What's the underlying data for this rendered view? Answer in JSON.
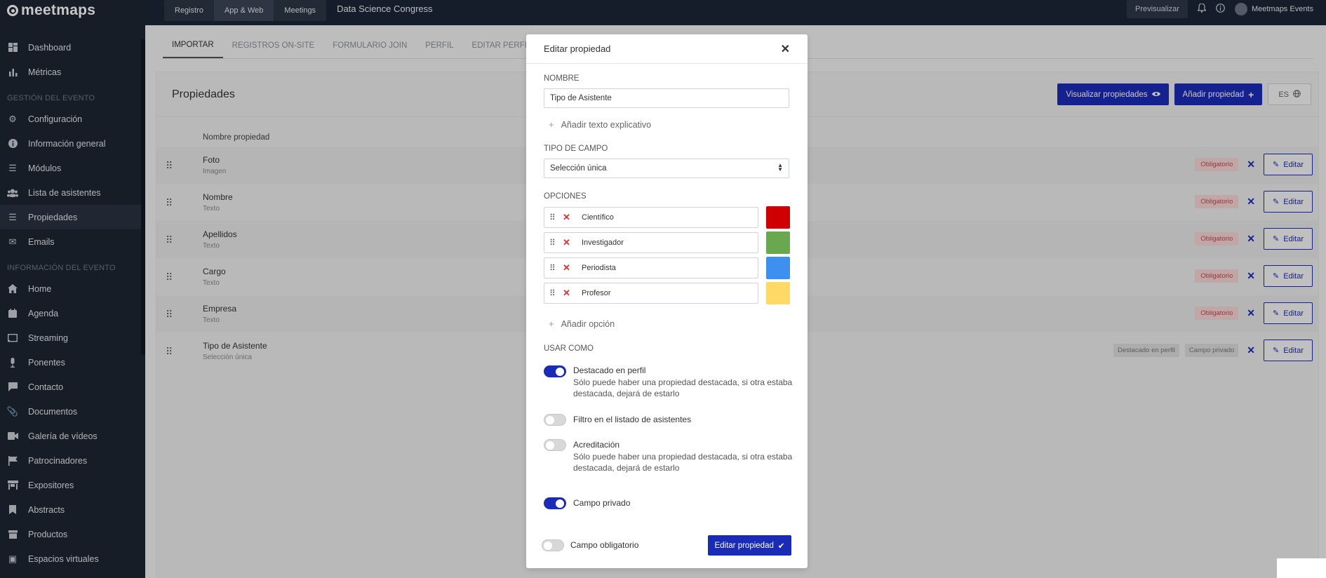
{
  "brand": "meetmaps",
  "sidebar": {
    "items_top": [
      {
        "label": "Dashboard",
        "icon": "dashboard-icon"
      },
      {
        "label": "Métricas",
        "icon": "bar-chart-icon"
      }
    ],
    "section_gestion": "GESTIÓN DEL EVENTO",
    "items_gestion": [
      {
        "label": "Configuración",
        "icon": "gear-icon"
      },
      {
        "label": "Información general",
        "icon": "info-icon"
      },
      {
        "label": "Módulos",
        "icon": "menu-icon"
      },
      {
        "label": "Lista de asistentes",
        "icon": "users-icon"
      },
      {
        "label": "Propiedades",
        "icon": "list-icon"
      },
      {
        "label": "Emails",
        "icon": "envelope-icon"
      }
    ],
    "section_info": "INFORMACIÓN DEL EVENTO",
    "items_info": [
      {
        "label": "Home",
        "icon": "home-icon"
      },
      {
        "label": "Agenda",
        "icon": "calendar-icon"
      },
      {
        "label": "Streaming",
        "icon": "cast-icon"
      },
      {
        "label": "Ponentes",
        "icon": "microphone-icon"
      },
      {
        "label": "Contacto",
        "icon": "chat-icon"
      },
      {
        "label": "Documentos",
        "icon": "paperclip-icon"
      },
      {
        "label": "Galería de vídeos",
        "icon": "video-icon"
      },
      {
        "label": "Patrocinadores",
        "icon": "flag-icon"
      },
      {
        "label": "Expositores",
        "icon": "store-icon"
      },
      {
        "label": "Abstracts",
        "icon": "bookmark-icon"
      },
      {
        "label": "Productos",
        "icon": "archive-icon"
      },
      {
        "label": "Espacios virtuales",
        "icon": "cube-icon"
      }
    ]
  },
  "topbar": {
    "nav": [
      "Registro",
      "App & Web",
      "Meetings"
    ],
    "event_title": "Data Science Congress",
    "preview": "Previsualizar",
    "user": "Meetmaps Events"
  },
  "tabs": [
    "IMPORTAR",
    "REGISTROS ON-SITE",
    "FORMULARIO JOIN",
    "PERFIL",
    "EDITAR PERFIL"
  ],
  "panel": {
    "title": "Propiedades",
    "visualize_btn": "Visualizar propiedades",
    "add_btn": "Añadir propiedad",
    "lang_btn": "ES",
    "col_header": "Nombre propiedad",
    "edit_label": "Editar",
    "rows": [
      {
        "name": "Foto",
        "type": "Imagen",
        "badges": [
          "Obligatorio"
        ]
      },
      {
        "name": "Nombre",
        "type": "Texto",
        "badges": [
          "Obligatorio"
        ]
      },
      {
        "name": "Apellidos",
        "type": "Texto",
        "badges": [
          "Obligatorio"
        ]
      },
      {
        "name": "Cargo",
        "type": "Texto",
        "badges": [
          "Obligatorio"
        ]
      },
      {
        "name": "Empresa",
        "type": "Texto",
        "badges": [
          "Obligatorio"
        ]
      },
      {
        "name": "Tipo de Asistente",
        "type": "Selección única",
        "badges": [
          "Destacado en perfil",
          "Campo privado"
        ]
      }
    ]
  },
  "modal": {
    "title": "Editar propiedad",
    "nombre_label": "NOMBRE",
    "nombre_value": "Tipo de Asistente",
    "add_text_link": "Añadir texto explicativo",
    "tipo_label": "TIPO DE CAMPO",
    "tipo_value": "Selección única",
    "opciones_label": "OPCIONES",
    "options": [
      {
        "label": "Científico",
        "color": "#d10000"
      },
      {
        "label": "Investigador",
        "color": "#6aa84f"
      },
      {
        "label": "Periodista",
        "color": "#3d8ff0"
      },
      {
        "label": "Profesor",
        "color": "#ffd966"
      }
    ],
    "add_option_link": "Añadir opción",
    "usar_label": "USAR COMO",
    "toggles": {
      "destacado": {
        "title": "Destacado en perfil",
        "desc": "Sólo puede haber una propiedad destacada, si otra estaba destacada, dejará de estarlo",
        "on": true
      },
      "filtro": {
        "title": "Filtro en el listado de asistentes",
        "on": false
      },
      "acreditacion": {
        "title": "Acreditación",
        "desc": "Sólo puede haber una propiedad destacada, si otra estaba destacada, dejará de estarlo",
        "on": false
      },
      "privado": {
        "title": "Campo privado",
        "on": true
      },
      "obligatorio": {
        "title": "Campo obligatorio",
        "on": false
      }
    },
    "submit": "Editar propiedad"
  },
  "colors": {
    "accent": "#1a2bb7",
    "sidebar_bg": "#1e2632",
    "topbar_bg": "#1c2636"
  }
}
